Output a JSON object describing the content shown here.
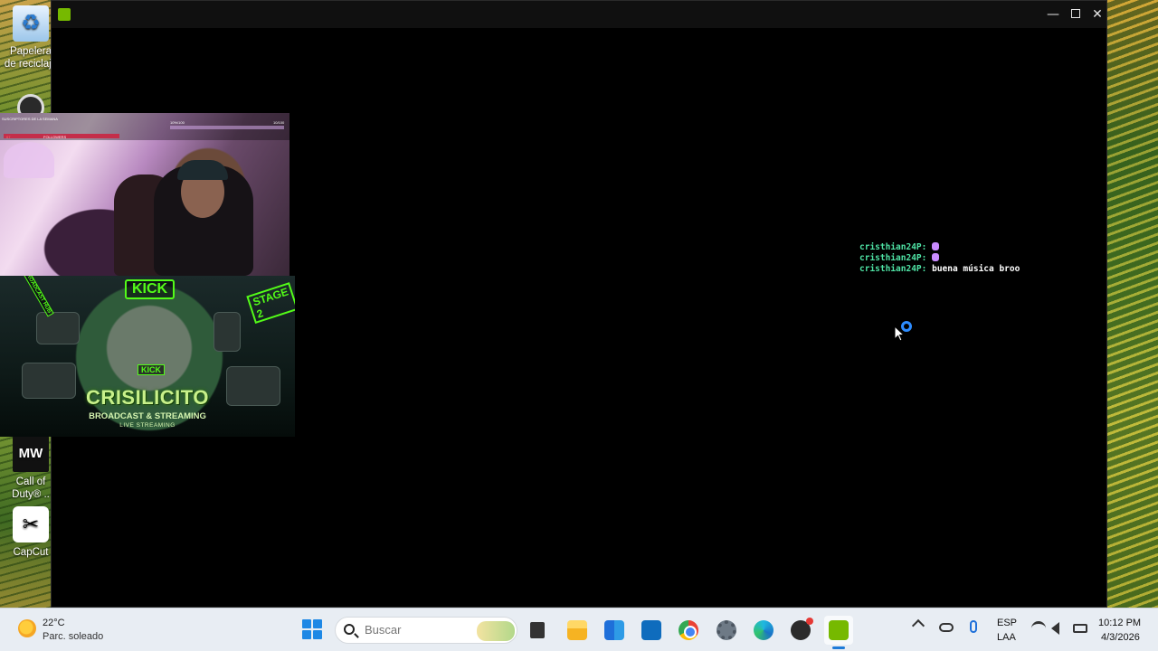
{
  "desktop": {
    "icons": [
      {
        "label": "Papelera de reciclaje",
        "icon": "recycle-bin-icon"
      },
      {
        "label": "",
        "icon": "app-icon"
      },
      {
        "label": "Call of Duty® ..",
        "icon": "call-of-duty-icon"
      },
      {
        "label": "CapCut",
        "icon": "capcut-icon"
      }
    ]
  },
  "window": {
    "app_icon": "nvidia-icon",
    "controls": {
      "minimize": "—",
      "close": "✕"
    }
  },
  "chat": {
    "lines": [
      {
        "user": "cristhian24P:",
        "message": "",
        "emote": true
      },
      {
        "user": "cristhian24P:",
        "message": "",
        "emote": true
      },
      {
        "user": "cristhian24P:",
        "message": "buena música broo",
        "emote": false
      }
    ],
    "user_color": "#4fe3a5"
  },
  "webcam": {
    "hud_subs": "SUSCRIPTORES DE LA SEMANA",
    "hud_followers": "FOLLOWERS",
    "hud_left_num": "67",
    "hud_goal_label": "10%/100",
    "hud_right_num": "10/100"
  },
  "banner": {
    "kick_top": "KICK",
    "kick_mid": "KICK",
    "stage_sign": "STAGE 2",
    "broadcast_sign": "BROADCAST HUB",
    "title": "CRISILICITO",
    "subtitle": "BROADCAST & STREAMING",
    "live": "LIVE STREAMING",
    "accent": "#53fc18"
  },
  "taskbar": {
    "weather": {
      "temp": "22°C",
      "desc": "Parc. soleado",
      "icon": "sun-icon"
    },
    "search": {
      "placeholder": "Buscar"
    },
    "apps": [
      "task-view-icon",
      "file-explorer-icon",
      "store-icon",
      "outlook-icon",
      "chrome-icon",
      "settings-icon",
      "edge-icon",
      "obs-icon",
      "nvidia-icon"
    ],
    "tray": {
      "lang_top": "ESP",
      "lang_bottom": "LAA",
      "time": "10:12 PM",
      "date": "4/3/2026"
    }
  }
}
